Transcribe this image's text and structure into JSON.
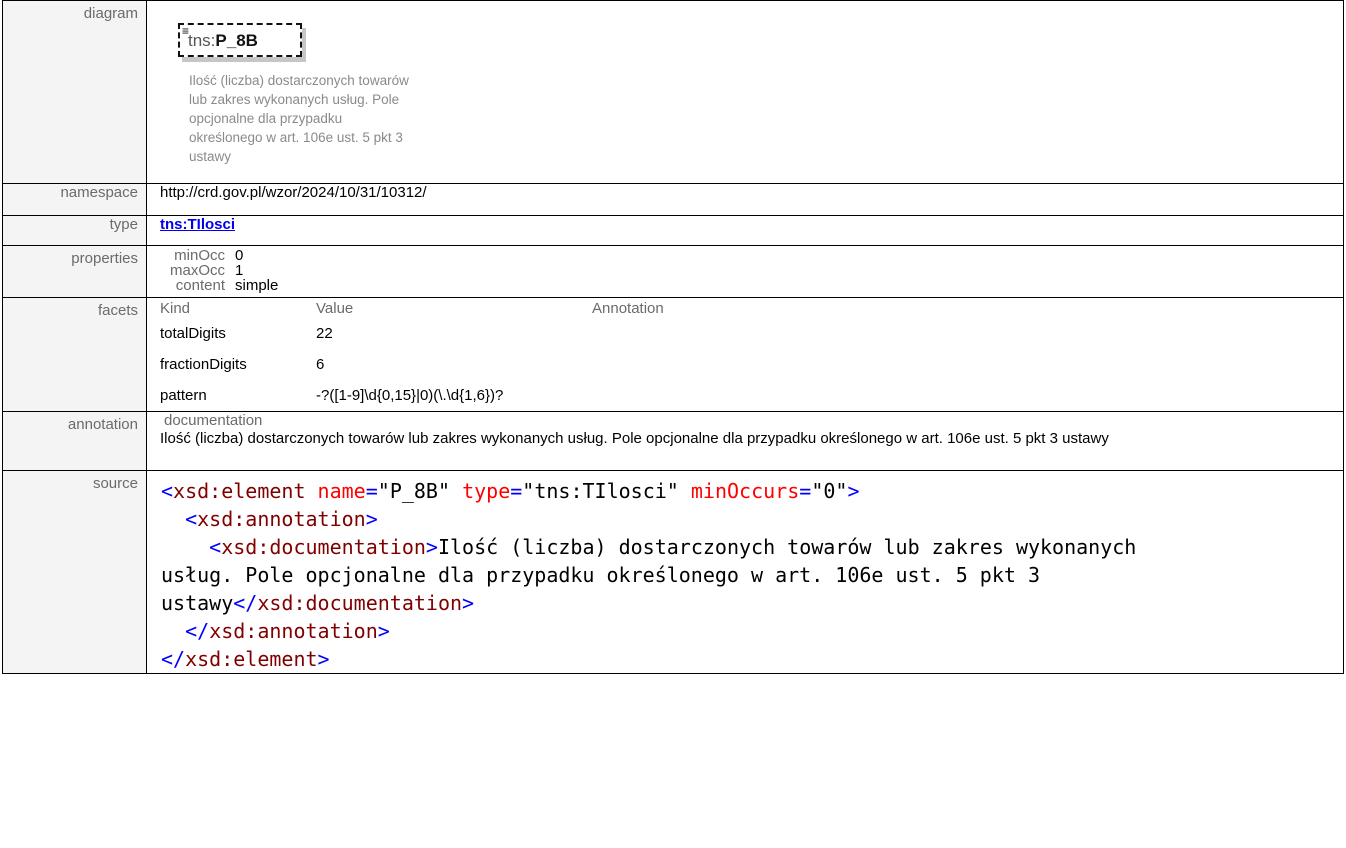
{
  "rows": {
    "diagram": {
      "label": "diagram",
      "element_prefix": "tns:",
      "element_name": "P_8B",
      "icon": "list-icon",
      "description": "Ilość (liczba) dostarczonych towarów lub zakres wykonanych usług. Pole opcjonalne dla przypadku określonego w art. 106e ust. 5 pkt 3 ustawy"
    },
    "namespace": {
      "label": "namespace",
      "value": "http://crd.gov.pl/wzor/2024/10/31/10312/"
    },
    "type": {
      "label": "type",
      "value": "tns:TIlosci"
    },
    "properties": {
      "label": "properties",
      "items": [
        {
          "key": "minOcc",
          "value": "0"
        },
        {
          "key": "maxOcc",
          "value": "1"
        },
        {
          "key": "content",
          "value": "simple"
        }
      ]
    },
    "facets": {
      "label": "facets",
      "headers": [
        "Kind",
        "Value",
        "Annotation"
      ],
      "items": [
        {
          "kind": "totalDigits",
          "value": "22",
          "annotation": ""
        },
        {
          "kind": "fractionDigits",
          "value": "6",
          "annotation": ""
        },
        {
          "kind": "pattern",
          "value": "-?([1-9]\\d{0,15}|0)(\\.\\d{1,6})?",
          "annotation": ""
        }
      ]
    },
    "annotation": {
      "label": "annotation",
      "heading": "documentation",
      "text": "Ilość (liczba) dostarczonych towarów lub zakres wykonanych usług. Pole opcjonalne dla przypadku określonego w art. 106e ust. 5 pkt 3 ustawy"
    },
    "source": {
      "label": "source",
      "element_tag": "xsd:element",
      "attr_name": "name",
      "attr_name_value": "P_8B",
      "attr_type": "type",
      "attr_type_value": "tns:TIlosci",
      "attr_min": "minOccurs",
      "attr_min_value": "0",
      "annotation_tag": "xsd:annotation",
      "documentation_tag": "xsd:documentation",
      "doc_line1": "Ilość (liczba) dostarczonych towarów lub zakres wykonanych",
      "doc_line2": "usług. Pole opcjonalne dla przypadku określonego w art. 106e ust. 5 pkt 3",
      "doc_line3": "ustawy"
    }
  },
  "colors": {
    "label_text": "#6b6b6b",
    "link": "#0000ee",
    "xml_bracket": "#0000ff",
    "xml_element": "#800000",
    "xml_attribute": "#ff0000"
  }
}
